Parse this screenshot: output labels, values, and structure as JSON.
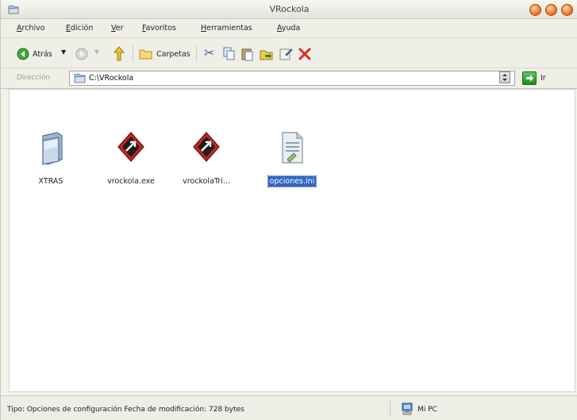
{
  "window": {
    "title": "VRockola"
  },
  "menu": [
    "Archivo",
    "Edición",
    "Ver",
    "Favoritos",
    "Herramientas",
    "Ayuda"
  ],
  "toolbar": {
    "back_label": "Atrás",
    "folders_label": "Carpetas"
  },
  "address": {
    "label": "Dirección",
    "value": "C:\\VRockola",
    "go_label": "Ir"
  },
  "files": [
    {
      "name": "XTRAS",
      "icon": "folder-icon"
    },
    {
      "name": "vrockola.exe",
      "icon": "vrockola-app-icon"
    },
    {
      "name": "vrockolaTri...",
      "icon": "vrockola-app-icon"
    },
    {
      "name": "opciones.ini",
      "icon": "ini-file-icon",
      "selected": true
    }
  ],
  "status": {
    "text": "Tipo: Opciones de configuración Fecha de modificación: 728 bytes",
    "zone": "Mi PC"
  },
  "colors": {
    "selection": "#3166c5",
    "window_bg": "#f2f1ea",
    "close_orange": "#f58b3b"
  }
}
